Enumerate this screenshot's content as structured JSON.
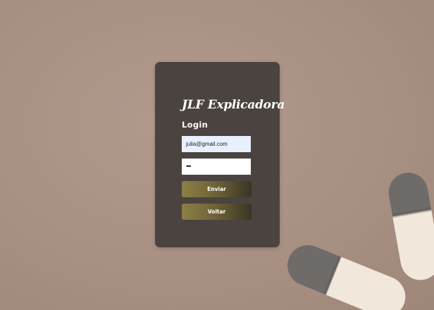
{
  "app": {
    "brand": "JLF Explicadora"
  },
  "login": {
    "heading": "Login",
    "email_value": "julia@gmail.com",
    "password_mask": "•••",
    "submit_label": "Enviar",
    "back_label": "Voltar"
  },
  "colors": {
    "background": "#a89082",
    "card": "#4b4340",
    "email_field_autofill": "#e8f0fe",
    "button_gradient_start": "#8c7f45",
    "button_gradient_end": "#3a3424",
    "pill_body": "#f1e7db",
    "pill_cap": "#6f6b68"
  },
  "icons": {
    "background_decoration": "pills-photo"
  }
}
